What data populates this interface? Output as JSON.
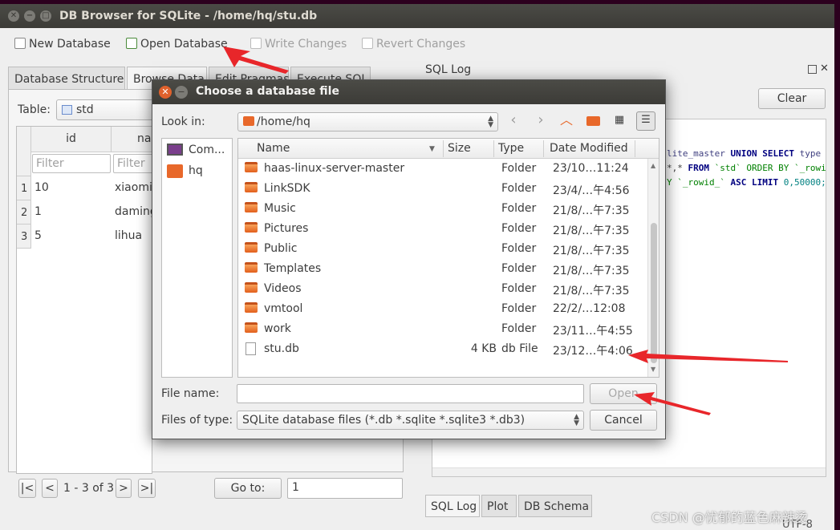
{
  "main_window": {
    "title": "DB Browser for SQLite - /home/hq/stu.db",
    "toolbar": {
      "new_database": "New Database",
      "open_database": "Open Database",
      "write_changes": "Write Changes",
      "revert_changes": "Revert Changes"
    },
    "tabs": [
      "Database Structure",
      "Browse Data",
      "Edit Pragmas",
      "Execute SQL"
    ],
    "table_label": "Table:",
    "table_value": "std",
    "columns": [
      "id",
      "name"
    ],
    "filter_placeholder": "Filter",
    "rows": [
      {
        "num": "1",
        "id": "10",
        "name": "xiaoming"
      },
      {
        "num": "2",
        "id": "1",
        "name": "daming"
      },
      {
        "num": "3",
        "id": "5",
        "name": "lihua"
      }
    ],
    "pager": {
      "first": "|<",
      "prev": "<",
      "range": "1 - 3 of 3",
      "next": ">",
      "last": ">|",
      "goto_label": "Go to:",
      "goto_value": "1"
    },
    "sql_log_title": "SQL Log",
    "clear_button": "Clear",
    "sql_lines": [
      {
        "a": "lite_master ",
        "b": "UNION SELECT ",
        "c": "type"
      },
      {
        "a": "*,* ",
        "b": "FROM ",
        "c": "`std` ORDER BY `_rowid"
      },
      {
        "a": "Y `_rowid_` ",
        "b": "ASC LIMIT ",
        "c": "0,50000;"
      }
    ],
    "bottom_tabs": [
      "SQL Log",
      "Plot",
      "DB Schema"
    ],
    "encoding": "UTF-8"
  },
  "dialog": {
    "title": "Choose a database file",
    "look_in_label": "Look in:",
    "look_in_value": "/home/hq",
    "places": [
      "Com...",
      "hq"
    ],
    "headers": {
      "name": "Name",
      "size": "Size",
      "type": "Type",
      "date": "Date Modified"
    },
    "files": [
      {
        "name": "haas-linux-server-master",
        "size": "",
        "type": "Folder",
        "date": "23/10…11:24",
        "kind": "folder"
      },
      {
        "name": "LinkSDK",
        "size": "",
        "type": "Folder",
        "date": "23/4/…午4:56",
        "kind": "folder"
      },
      {
        "name": "Music",
        "size": "",
        "type": "Folder",
        "date": "21/8/…午7:35",
        "kind": "folder"
      },
      {
        "name": "Pictures",
        "size": "",
        "type": "Folder",
        "date": "21/8/…午7:35",
        "kind": "folder"
      },
      {
        "name": "Public",
        "size": "",
        "type": "Folder",
        "date": "21/8/…午7:35",
        "kind": "folder"
      },
      {
        "name": "Templates",
        "size": "",
        "type": "Folder",
        "date": "21/8/…午7:35",
        "kind": "folder"
      },
      {
        "name": "Videos",
        "size": "",
        "type": "Folder",
        "date": "21/8/…午7:35",
        "kind": "folder"
      },
      {
        "name": "vmtool",
        "size": "",
        "type": "Folder",
        "date": "22/2/…12:08",
        "kind": "folder"
      },
      {
        "name": "work",
        "size": "",
        "type": "Folder",
        "date": "23/11…午4:55",
        "kind": "folder"
      },
      {
        "name": "stu.db",
        "size": "4 KB",
        "type": "db File",
        "date": "23/12…午4:06",
        "kind": "file"
      }
    ],
    "file_name_label": "File name:",
    "file_name_value": "",
    "files_of_type_label": "Files of type:",
    "files_of_type_value": "SQLite database files (*.db *.sqlite *.sqlite3 *.db3)",
    "open_button": "Open",
    "cancel_button": "Cancel"
  },
  "watermark": "CSDN @忧郁的蓝色麻辣烫",
  "colors": {
    "annotation_arrow": "#e8262a",
    "folder": "#e8682a",
    "titlebar": "#3c3b37"
  }
}
